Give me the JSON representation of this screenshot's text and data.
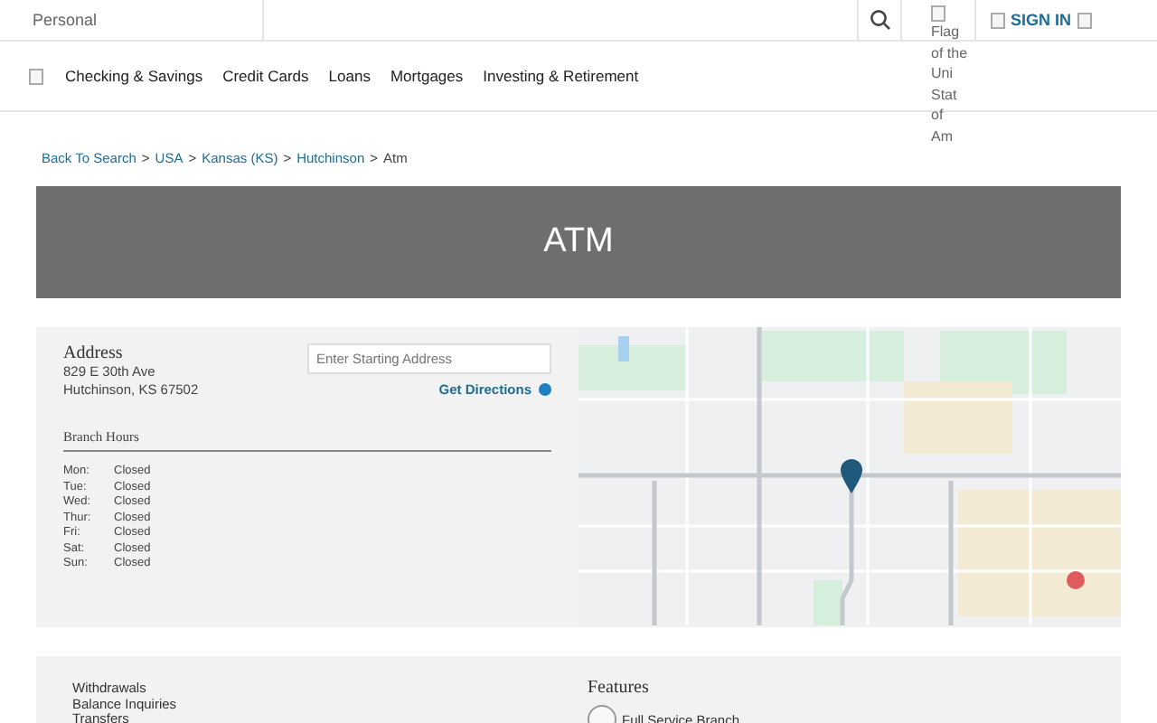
{
  "top_bar": {
    "segment": "Personal",
    "flag_alt": "Flag of the Uni Stat of Am",
    "sign_in": "SIGN IN"
  },
  "nav": {
    "items": [
      "Checking & Savings",
      "Credit Cards",
      "Loans",
      "Mortgages",
      "Investing & Retirement"
    ]
  },
  "breadcrumb": [
    {
      "kind": "link",
      "label": "Back To Search"
    },
    {
      "kind": "separator",
      "label": ">"
    },
    {
      "kind": "link",
      "label": "USA"
    },
    {
      "kind": "separator",
      "label": ">"
    },
    {
      "kind": "link",
      "label": "Kansas (KS)"
    },
    {
      "kind": "separator",
      "label": ">"
    },
    {
      "kind": "link",
      "label": "Hutchinson"
    },
    {
      "kind": "separator",
      "label": ">"
    },
    {
      "kind": "current",
      "label": "Atm"
    }
  ],
  "hero": {
    "title": "ATM"
  },
  "location": {
    "address_heading": "Address",
    "address_lines": [
      "829 E 30th Ave",
      "Hutchinson, KS 67502"
    ],
    "directions_placeholder": "Enter Starting Address",
    "directions_button": "Get Directions",
    "hours_heading": "Branch Hours",
    "hours": [
      {
        "day": "Mon:",
        "time": "Closed"
      },
      {
        "day": "Tue:",
        "time": "Closed"
      },
      {
        "day": "Wed:",
        "time": "Closed"
      },
      {
        "day": "Thur:",
        "time": "Closed"
      },
      {
        "day": "Fri:",
        "time": "Closed"
      },
      {
        "day": "Sat:",
        "time": "Closed"
      },
      {
        "day": "Sun:",
        "time": "Closed"
      }
    ]
  },
  "services": {
    "items": [
      "Withdrawals",
      "Balance Inquiries",
      "Transfers"
    ],
    "features_heading": "Features",
    "features": [
      "Full Service Branch"
    ]
  }
}
